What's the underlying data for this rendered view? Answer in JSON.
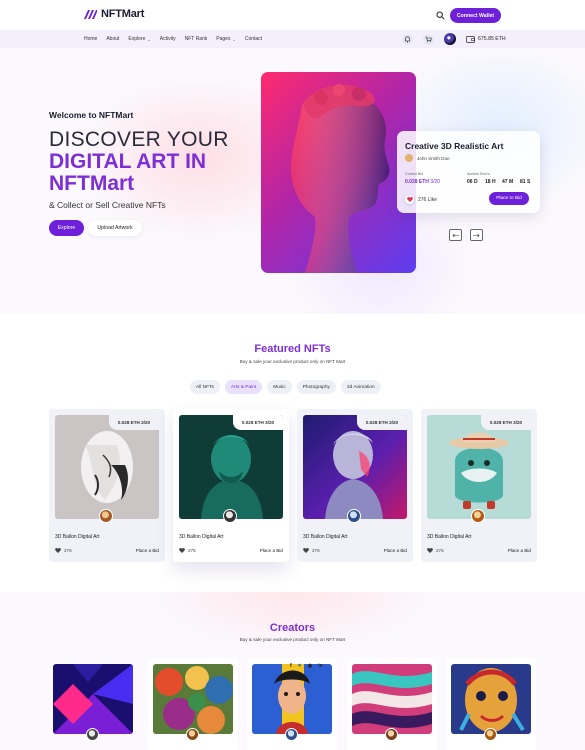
{
  "brand": {
    "name": "NFTMart",
    "accent": "#6d1fd9",
    "highlight": "#7d2fd6"
  },
  "header": {
    "connect_label": "Connect Wallet",
    "search_icon": "search-icon"
  },
  "nav": {
    "links": [
      "Home",
      "About",
      "Explore",
      "Activity",
      "NFT Rank",
      "Pages",
      "Contact"
    ],
    "balance": "675.85 ETH"
  },
  "hero": {
    "welcome": "Welcome to NFTMart",
    "line1": "DISCOVER YOUR",
    "line2": "DIGITAL ART IN",
    "line3": "NFTMart",
    "subtitle": "& Collect or Sell Creative NFTs",
    "explore_label": "Explore",
    "upload_label": "Upload Artwork",
    "card": {
      "title": "Creative 3D Realistic Art",
      "author": "John Smith Doe",
      "current_bid_label": "Current Bid",
      "current_bid": "0.028 ETH",
      "bid_fraction": "3/20",
      "auction_label": "Auction End in",
      "countdown": [
        "06 D",
        "18 H",
        "47 M",
        "81 S"
      ],
      "likes": "276 Like",
      "bid_button": "Place to Bid"
    },
    "prev_icon": "arrow-left-icon",
    "next_icon": "arrow-right-icon"
  },
  "featured": {
    "title": "Featured NFTs",
    "subtitle": "Buy & sale your exclusive product only on NFT Mart",
    "filters": [
      "All NFTs",
      "Arts & Paint",
      "Music",
      "Photography",
      "3d Animation"
    ],
    "active_filter": "Arts & Paint",
    "cards": [
      {
        "price": "0.028 ETH 3/20",
        "name": "3D Ballon Digital Art",
        "likes": "276",
        "action": "Place a Bid"
      },
      {
        "price": "0.028 ETH 3/20",
        "name": "3D Ballon Digital Art",
        "likes": "276",
        "action": "Place a Bid"
      },
      {
        "price": "0.028 ETH 3/20",
        "name": "3D Ballon Digital Art",
        "likes": "276",
        "action": "Place a Bid"
      },
      {
        "price": "0.028 ETH 3/20",
        "name": "3D Ballon Digital Art",
        "likes": "276",
        "action": "Place a Bid"
      }
    ]
  },
  "creators": {
    "title": "Creators",
    "subtitle": "Buy & sale your exclusive product only on NFT Mart",
    "social_icons": [
      "facebook-icon",
      "twitter-icon",
      "instagram-icon",
      "linkedin-icon"
    ]
  }
}
